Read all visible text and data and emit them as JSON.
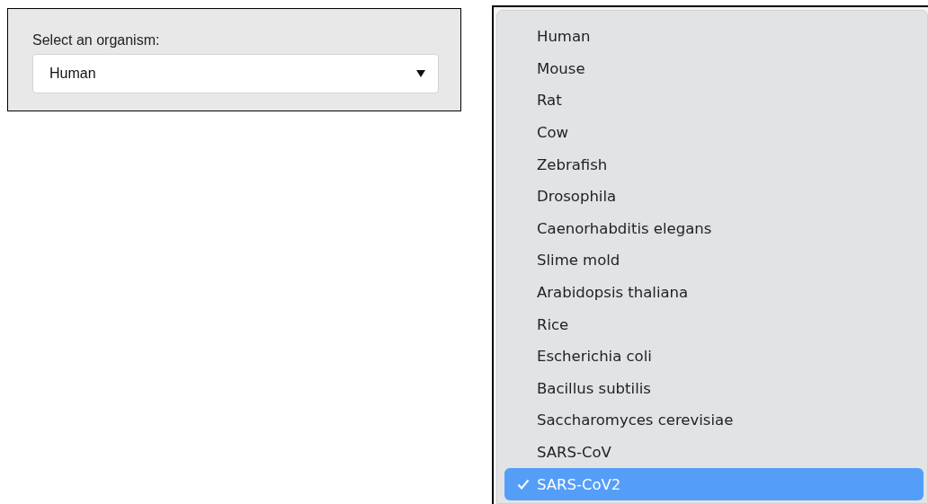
{
  "organism_select": {
    "label": "Select an organism:",
    "value": "Human"
  },
  "dropdown_menu": {
    "items": [
      {
        "label": "Human",
        "selected": false
      },
      {
        "label": "Mouse",
        "selected": false
      },
      {
        "label": "Rat",
        "selected": false
      },
      {
        "label": "Cow",
        "selected": false
      },
      {
        "label": "Zebrafish",
        "selected": false
      },
      {
        "label": "Drosophila",
        "selected": false
      },
      {
        "label": "Caenorhabditis elegans",
        "selected": false
      },
      {
        "label": "Slime mold",
        "selected": false
      },
      {
        "label": "Arabidopsis thaliana",
        "selected": false
      },
      {
        "label": "Rice",
        "selected": false
      },
      {
        "label": "Escherichia coli",
        "selected": false
      },
      {
        "label": "Bacillus subtilis",
        "selected": false
      },
      {
        "label": "Saccharomyces cerevisiae",
        "selected": false
      },
      {
        "label": "SARS-CoV",
        "selected": false
      },
      {
        "label": "SARS-CoV2",
        "selected": true
      }
    ]
  }
}
